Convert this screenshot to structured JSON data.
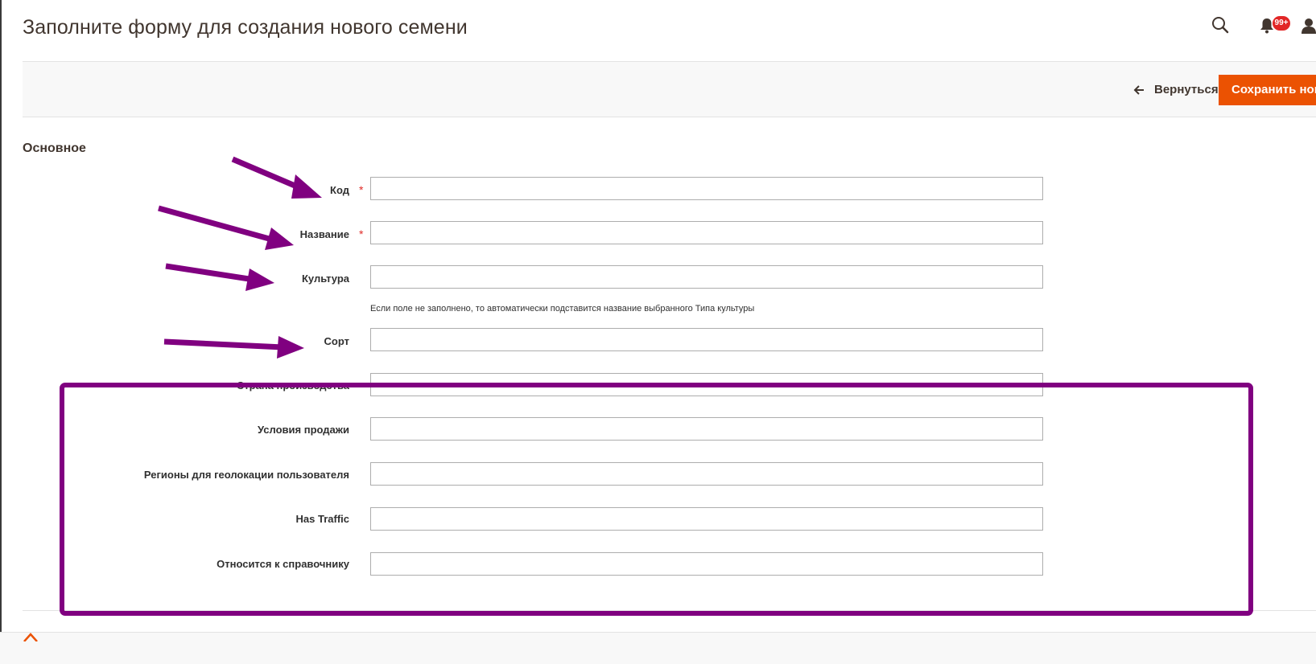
{
  "page": {
    "title": "Заполните форму для создания нового семени",
    "notifications_count": "99+"
  },
  "actions": {
    "back_label": "Вернуться",
    "save_label": "Сохранить новое семя"
  },
  "section": {
    "title": "Основное"
  },
  "fields": [
    {
      "label": "Код",
      "required": true,
      "value": ""
    },
    {
      "label": "Название",
      "required": true,
      "value": ""
    },
    {
      "label": "Культура",
      "required": false,
      "value": "",
      "note": "Если поле не заполнено, то автоматически подставится название выбранного Типа культуры"
    },
    {
      "label": "Сорт",
      "required": false,
      "value": ""
    },
    {
      "label": "Страна производства",
      "required": false,
      "value": ""
    },
    {
      "label": "Условия продажи",
      "required": false,
      "value": ""
    },
    {
      "label": "Регионы для геолокации пользователя",
      "required": false,
      "value": ""
    },
    {
      "label": "Has Traffic",
      "required": false,
      "value": ""
    },
    {
      "label": "Относится к справочнику",
      "required": false,
      "value": ""
    }
  ],
  "required_marker": "*",
  "colors": {
    "accent": "#eb5202",
    "annotation": "#800080",
    "required": "#e02b27"
  }
}
